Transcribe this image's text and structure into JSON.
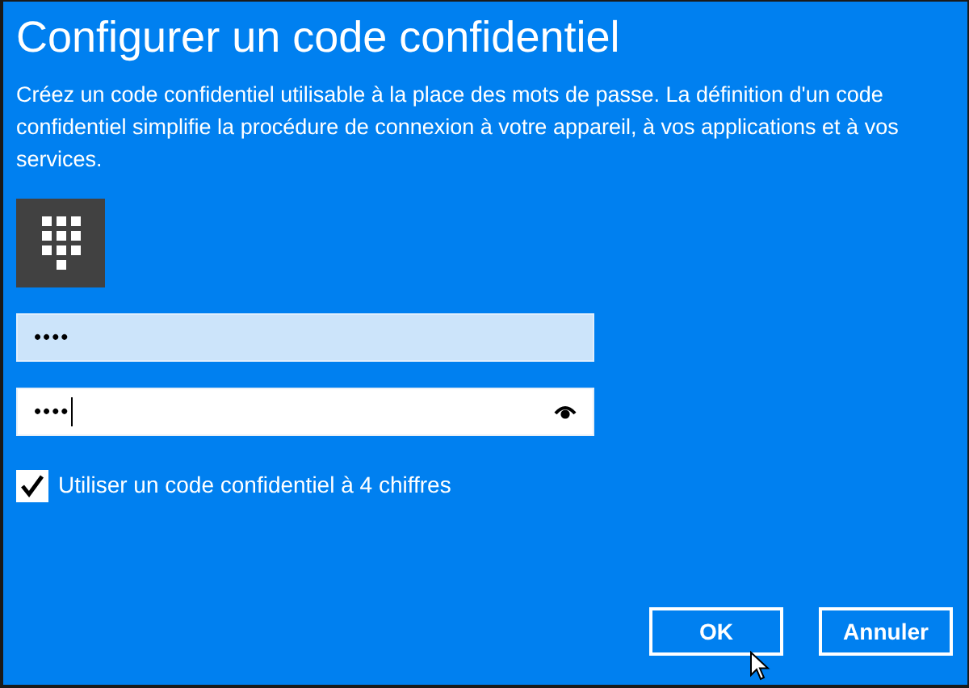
{
  "title": "Configurer un code confidentiel",
  "description": "Créez un code confidentiel utilisable à la place des mots de passe. La définition d'un code confidentiel simplifie la procédure de connexion à votre appareil, à vos applications et à vos services.",
  "fields": [
    {
      "value": "••••",
      "focused": false,
      "highlighted": true,
      "reveal_icon": false
    },
    {
      "value": "••••",
      "focused": true,
      "highlighted": false,
      "reveal_icon": true
    }
  ],
  "checkbox": {
    "label": "Utiliser un code confidentiel à 4 chiffres",
    "checked": true
  },
  "buttons": [
    {
      "label": "OK"
    },
    {
      "label": "Annuler"
    }
  ]
}
